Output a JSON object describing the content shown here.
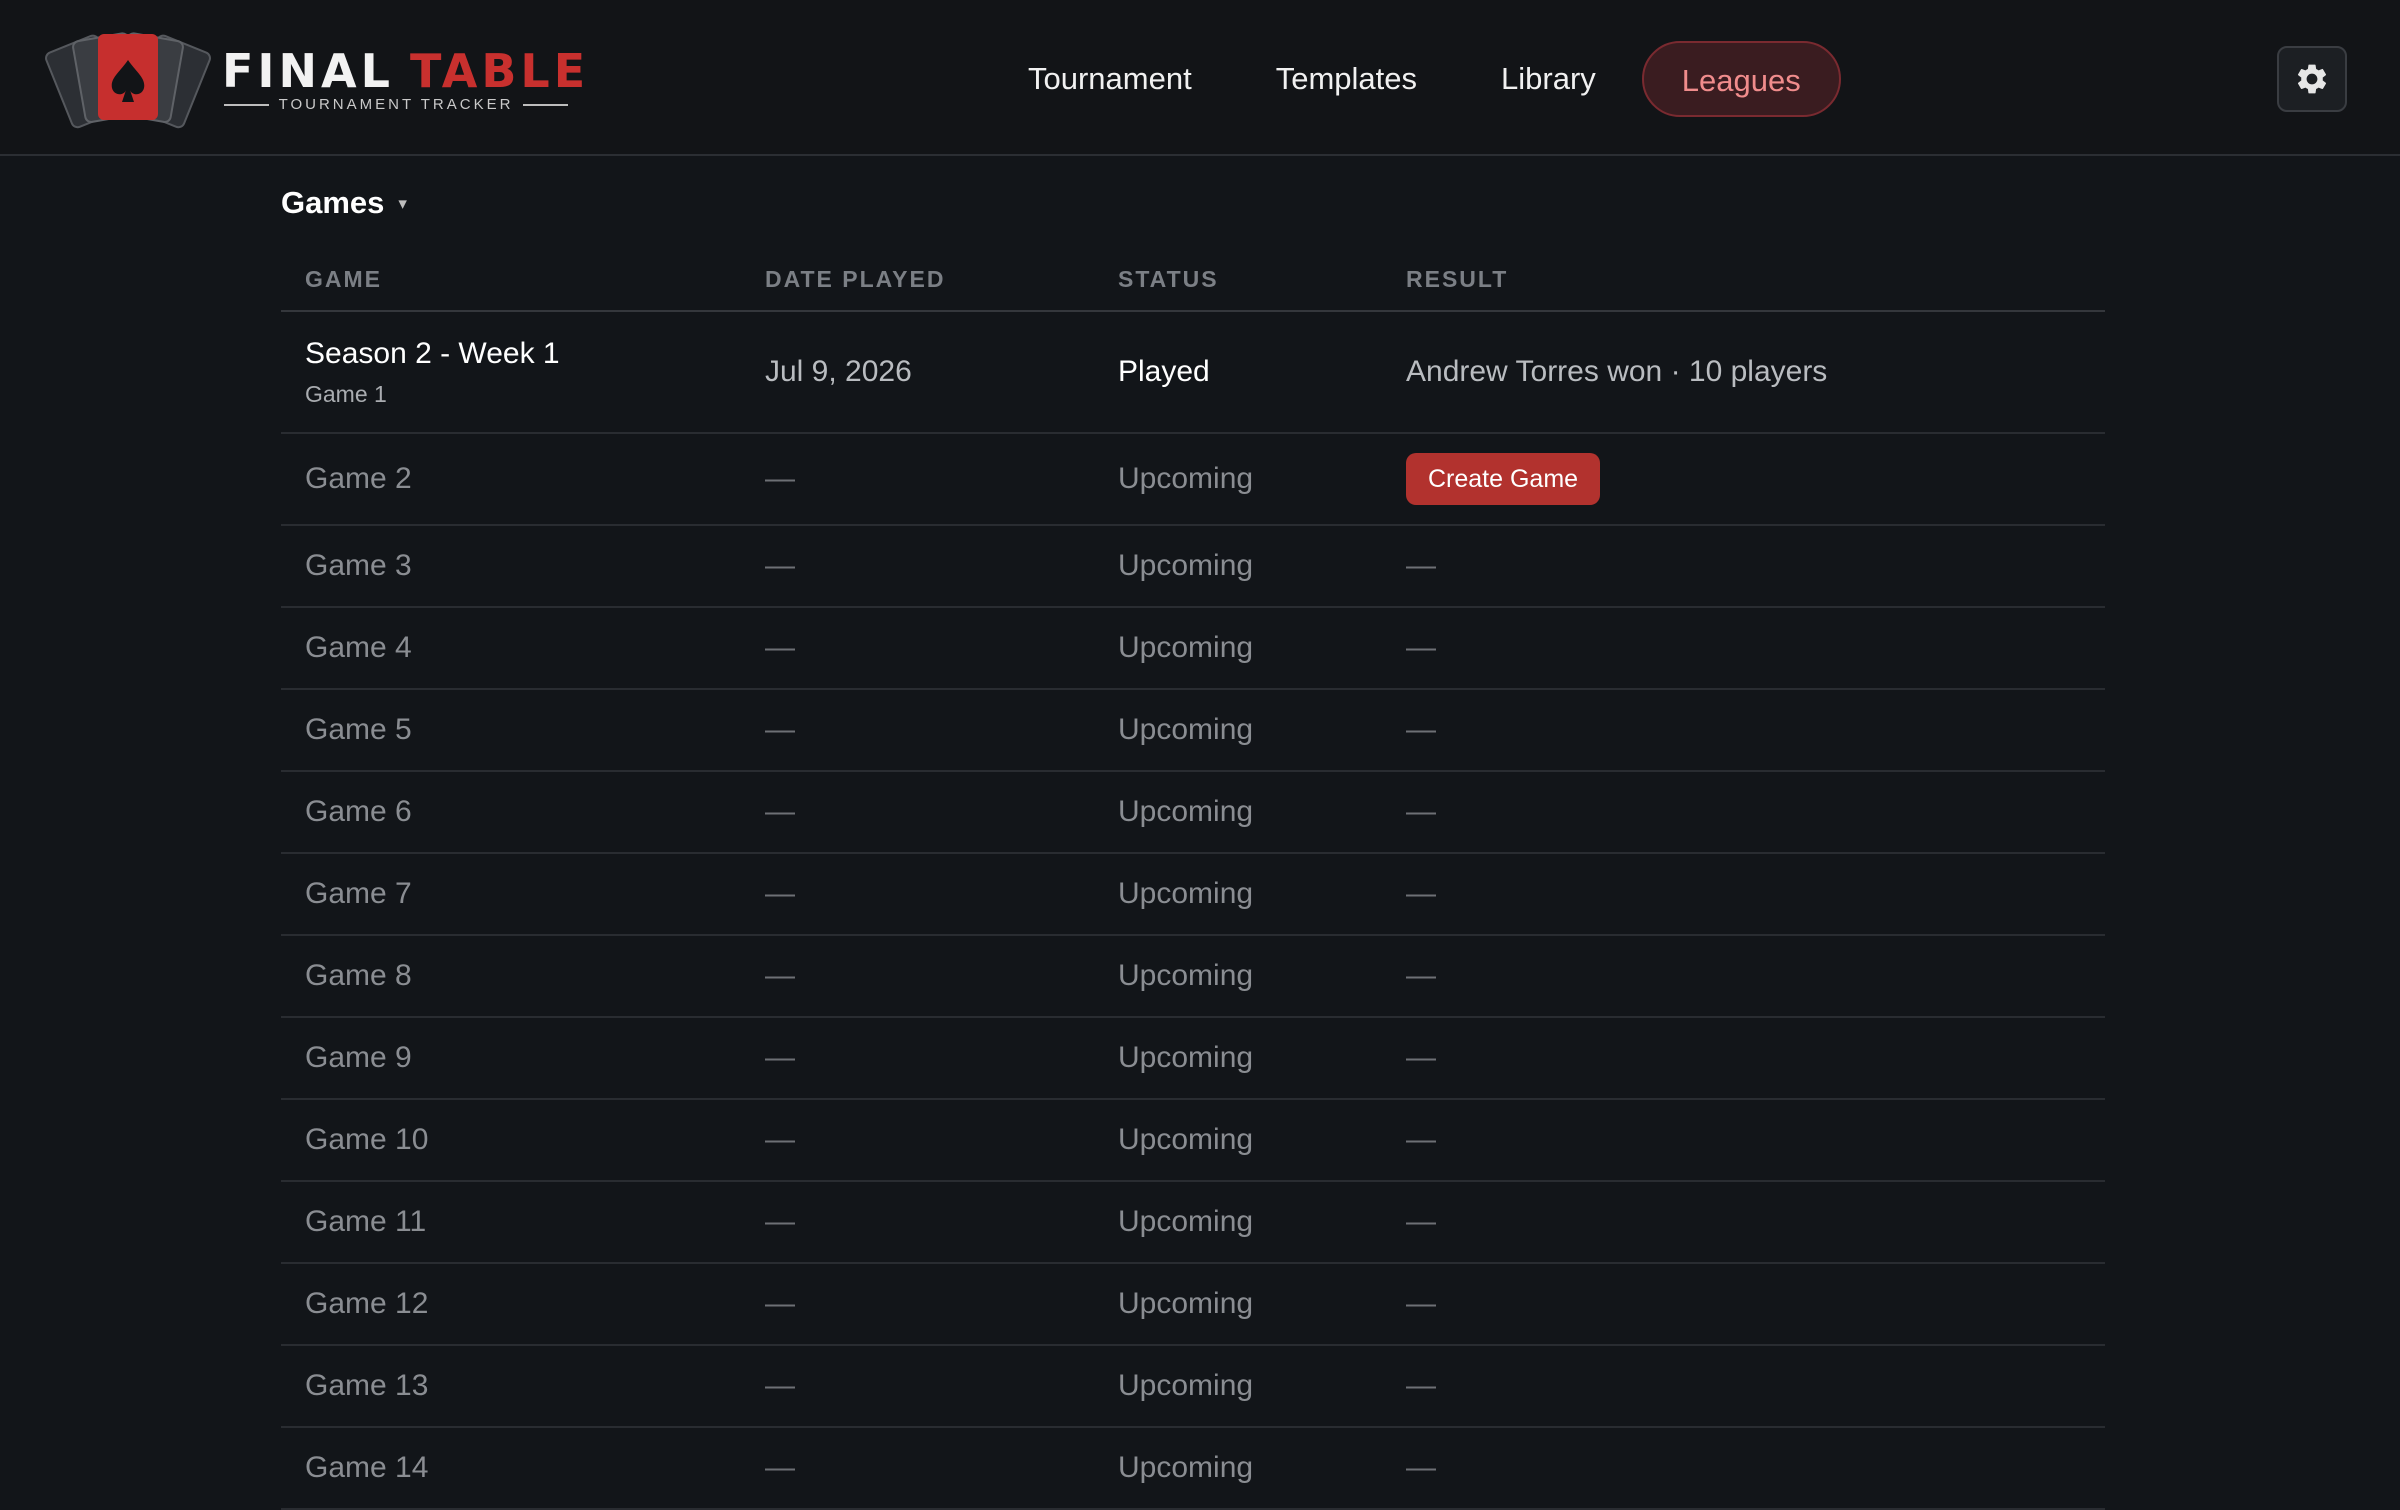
{
  "brand": {
    "word1": "FINAL",
    "word2": "TABLE",
    "tagline": "TOURNAMENT TRACKER",
    "accent_color": "#c8302e"
  },
  "nav": {
    "items": [
      {
        "label": "Tournament",
        "active": false
      },
      {
        "label": "Templates",
        "active": false
      },
      {
        "label": "Library",
        "active": false
      },
      {
        "label": "Leagues",
        "active": true
      }
    ]
  },
  "settings": {
    "icon": "gear-icon"
  },
  "games_section": {
    "title": "Games",
    "caret": "▾",
    "columns": [
      "GAME",
      "DATE PLAYED",
      "STATUS",
      "RESULT"
    ],
    "played": {
      "title": "Season 2 - Week 1",
      "subtitle": "Game 1",
      "date": "Jul 9, 2026",
      "status": "Played",
      "result": "Andrew Torres won · 10 players"
    },
    "next": {
      "game": "Game 2",
      "date": "—",
      "status": "Upcoming",
      "button_label": "Create Game"
    },
    "upcoming": [
      {
        "game": "Game 3",
        "date": "—",
        "status": "Upcoming",
        "result": "—"
      },
      {
        "game": "Game 4",
        "date": "—",
        "status": "Upcoming",
        "result": "—"
      },
      {
        "game": "Game 5",
        "date": "—",
        "status": "Upcoming",
        "result": "—"
      },
      {
        "game": "Game 6",
        "date": "—",
        "status": "Upcoming",
        "result": "—"
      },
      {
        "game": "Game 7",
        "date": "—",
        "status": "Upcoming",
        "result": "—"
      },
      {
        "game": "Game 8",
        "date": "—",
        "status": "Upcoming",
        "result": "—"
      },
      {
        "game": "Game 9",
        "date": "—",
        "status": "Upcoming",
        "result": "—"
      },
      {
        "game": "Game 10",
        "date": "—",
        "status": "Upcoming",
        "result": "—"
      },
      {
        "game": "Game 11",
        "date": "—",
        "status": "Upcoming",
        "result": "—"
      },
      {
        "game": "Game 12",
        "date": "—",
        "status": "Upcoming",
        "result": "—"
      },
      {
        "game": "Game 13",
        "date": "—",
        "status": "Upcoming",
        "result": "—"
      },
      {
        "game": "Game 14",
        "date": "—",
        "status": "Upcoming",
        "result": "—"
      }
    ]
  }
}
